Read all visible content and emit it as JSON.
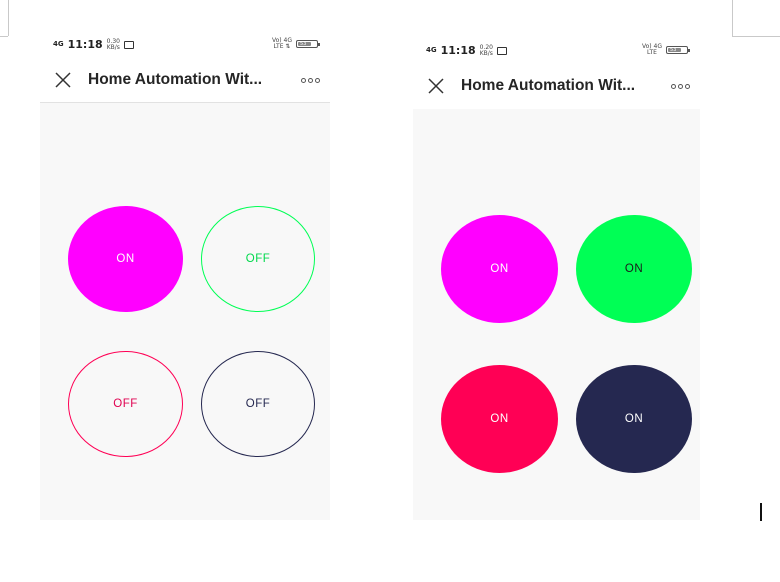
{
  "left_screen": {
    "status": {
      "network": "4G",
      "time": "11:18",
      "speed_value": "0.30",
      "speed_unit": "KB/s",
      "volte": "Vo) 4G",
      "volte_sub": "LTE ⇅",
      "battery": "53"
    },
    "header": {
      "title": "Home Automation  Wit..."
    },
    "buttons": [
      {
        "label": "ON",
        "color": "#ff00ff",
        "text_color": "#ffffff",
        "state": "on"
      },
      {
        "label": "OFF",
        "color": "#00ff55",
        "text_color": "#00e050",
        "state": "off"
      },
      {
        "label": "OFF",
        "color": "#ff0055",
        "text_color": "#e00050",
        "state": "off"
      },
      {
        "label": "OFF",
        "color": "#252850",
        "text_color": "#252850",
        "state": "off"
      }
    ]
  },
  "right_screen": {
    "status": {
      "network": "4G",
      "time": "11:18",
      "speed_value": "0.20",
      "speed_unit": "KB/s",
      "volte": "Vo) 4G",
      "volte_sub": "LTE",
      "battery": "53"
    },
    "header": {
      "title": "Home Automation  Wit..."
    },
    "buttons": [
      {
        "label": "ON",
        "color": "#ff00ff",
        "text_color": "#ffffff",
        "state": "on"
      },
      {
        "label": "ON",
        "color": "#00ff55",
        "text_color": "#1a1a1a",
        "state": "on"
      },
      {
        "label": "ON",
        "color": "#ff0055",
        "text_color": "#ffffff",
        "state": "on"
      },
      {
        "label": "ON",
        "color": "#252850",
        "text_color": "#ffffff",
        "state": "on"
      }
    ]
  }
}
